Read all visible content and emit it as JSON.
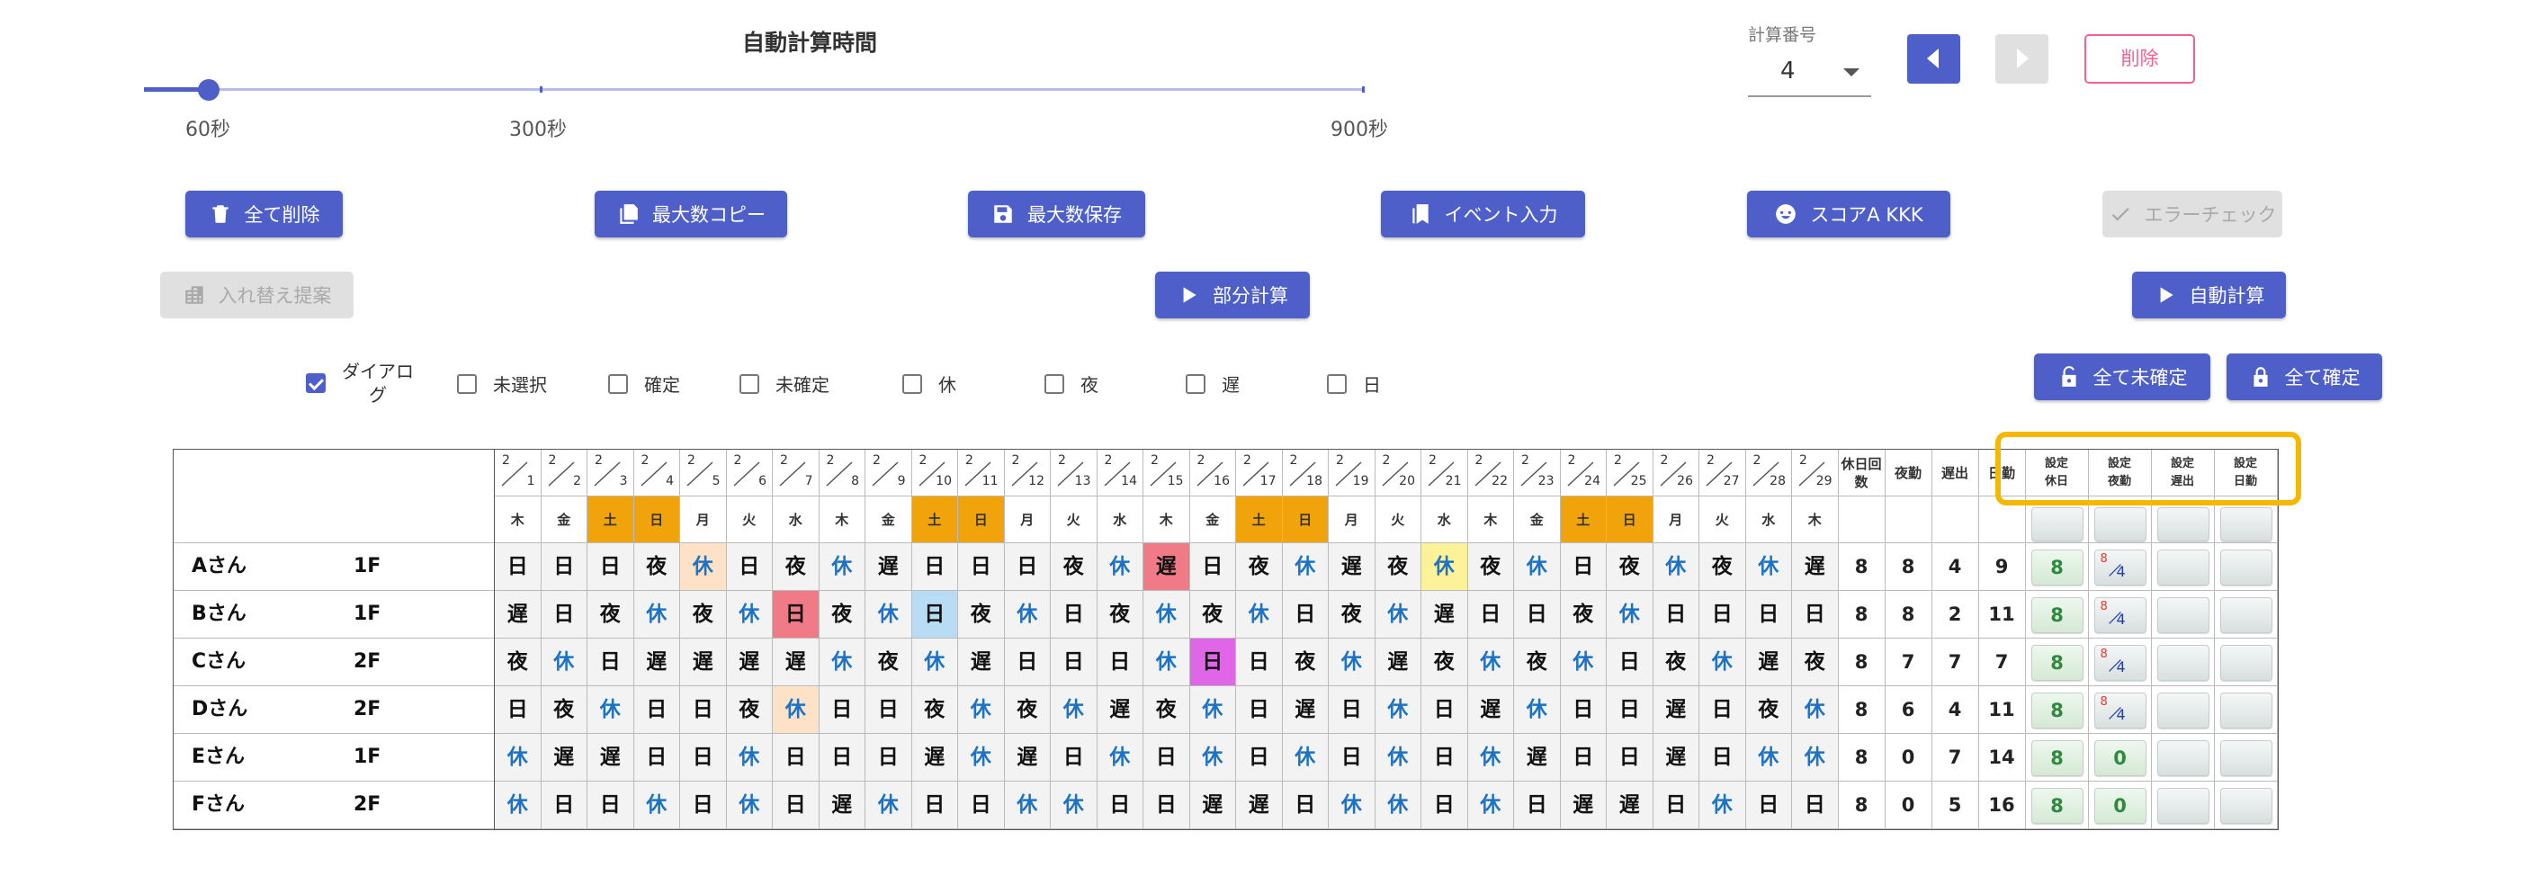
{
  "slider": {
    "title": "自動計算時間",
    "labels": [
      "60秒",
      "300秒",
      "900秒"
    ],
    "value_seconds": 60
  },
  "calc": {
    "label": "計算番号",
    "value": "4",
    "delete_label": "削除"
  },
  "buttons": {
    "delete_all": "全て削除",
    "copy_max": "最大数コピー",
    "save_max": "最大数保存",
    "event_input": "イベント入力",
    "score": "スコアA KKK",
    "error_check": "エラーチェック",
    "swap_suggest": "入れ替え提案",
    "partial_calc": "部分計算",
    "auto_calc": "自動計算",
    "all_unconfirm": "全て未確定",
    "all_confirm": "全て確定"
  },
  "filters": {
    "dialog": "ダイアロ\nグ",
    "unselected": "未選択",
    "confirmed": "確定",
    "unconfirmed": "未確定",
    "rest": "休",
    "night": "夜",
    "late": "遅",
    "day": "日"
  },
  "colors": {
    "accent": "#4e5fc9",
    "weekend": "#f0a30a",
    "rest_text": "#1e72c4",
    "highlight": "#f5b700"
  },
  "table": {
    "month": "2",
    "days": [
      "1",
      "2",
      "3",
      "4",
      "5",
      "6",
      "7",
      "8",
      "9",
      "10",
      "11",
      "12",
      "13",
      "14",
      "15",
      "16",
      "17",
      "18",
      "19",
      "20",
      "21",
      "22",
      "23",
      "24",
      "25",
      "26",
      "27",
      "28",
      "29"
    ],
    "dow": [
      "木",
      "金",
      "土",
      "日",
      "月",
      "火",
      "水",
      "木",
      "金",
      "土",
      "日",
      "月",
      "火",
      "水",
      "木",
      "金",
      "土",
      "日",
      "月",
      "火",
      "水",
      "木",
      "金",
      "土",
      "日",
      "月",
      "火",
      "水",
      "木"
    ],
    "stat_headers": [
      "休日回\n数",
      "夜勤",
      "遅出",
      "日勤"
    ],
    "setting_headers": [
      "設定\n休日",
      "設定\n夜勤",
      "設定\n遅出",
      "設定\n日勤"
    ],
    "rows": [
      {
        "name": "Aさん",
        "floor": "1F",
        "shifts": [
          "日",
          "日",
          "日",
          "夜",
          "休",
          "日",
          "夜",
          "休",
          "遅",
          "日",
          "日",
          "日",
          "夜",
          "休",
          "遅",
          "日",
          "夜",
          "休",
          "遅",
          "夜",
          "休",
          "夜",
          "休",
          "日",
          "夜",
          "休",
          "夜",
          "休",
          "遅"
        ],
        "stats": [
          "8",
          "8",
          "4",
          "9"
        ],
        "set_rest": "8",
        "set_night": {
          "num": "8",
          "den": "4"
        }
      },
      {
        "name": "Bさん",
        "floor": "1F",
        "shifts": [
          "遅",
          "日",
          "夜",
          "休",
          "夜",
          "休",
          "日",
          "夜",
          "休",
          "日",
          "夜",
          "休",
          "日",
          "夜",
          "休",
          "夜",
          "休",
          "日",
          "夜",
          "休",
          "遅",
          "日",
          "日",
          "夜",
          "休",
          "日",
          "日",
          "日",
          "日"
        ],
        "stats": [
          "8",
          "8",
          "2",
          "11"
        ],
        "set_rest": "8",
        "set_night": {
          "num": "8",
          "den": "4"
        }
      },
      {
        "name": "Cさん",
        "floor": "2F",
        "shifts": [
          "夜",
          "休",
          "日",
          "遅",
          "遅",
          "遅",
          "遅",
          "休",
          "夜",
          "休",
          "遅",
          "日",
          "日",
          "日",
          "休",
          "日",
          "日",
          "夜",
          "休",
          "遅",
          "夜",
          "休",
          "夜",
          "休",
          "日",
          "夜",
          "休",
          "遅",
          "夜"
        ],
        "stats": [
          "8",
          "7",
          "7",
          "7"
        ],
        "set_rest": "8",
        "set_night": {
          "num": "8",
          "den": "4"
        }
      },
      {
        "name": "Dさん",
        "floor": "2F",
        "shifts": [
          "日",
          "夜",
          "休",
          "日",
          "日",
          "夜",
          "休",
          "日",
          "日",
          "夜",
          "休",
          "夜",
          "休",
          "遅",
          "夜",
          "休",
          "日",
          "遅",
          "日",
          "休",
          "日",
          "遅",
          "休",
          "日",
          "日",
          "遅",
          "日",
          "夜",
          "休"
        ],
        "stats": [
          "8",
          "6",
          "4",
          "11"
        ],
        "set_rest": "8",
        "set_night": {
          "num": "8",
          "den": "4"
        }
      },
      {
        "name": "Eさん",
        "floor": "1F",
        "shifts": [
          "休",
          "遅",
          "遅",
          "日",
          "日",
          "休",
          "日",
          "日",
          "日",
          "遅",
          "休",
          "遅",
          "日",
          "休",
          "日",
          "休",
          "日",
          "休",
          "日",
          "休",
          "日",
          "休",
          "遅",
          "日",
          "日",
          "遅",
          "日",
          "休",
          "休"
        ],
        "stats": [
          "8",
          "0",
          "7",
          "14"
        ],
        "set_rest": "8",
        "set_night": {
          "num": "0",
          "den": ""
        }
      },
      {
        "name": "Fさん",
        "floor": "2F",
        "shifts": [
          "休",
          "日",
          "日",
          "休",
          "日",
          "休",
          "日",
          "遅",
          "休",
          "日",
          "日",
          "休",
          "休",
          "日",
          "日",
          "遅",
          "遅",
          "日",
          "休",
          "休",
          "日",
          "休",
          "日",
          "遅",
          "遅",
          "日",
          "休",
          "日",
          "日"
        ],
        "stats": [
          "8",
          "0",
          "5",
          "16"
        ],
        "set_rest": "8",
        "set_night": {
          "num": "0",
          "den": ""
        }
      }
    ],
    "cell_highlights": [
      {
        "row": 0,
        "col": 4,
        "color": "#fde2c8"
      },
      {
        "row": 0,
        "col": 14,
        "color": "#f07a86"
      },
      {
        "row": 0,
        "col": 20,
        "color": "#fbf29a"
      },
      {
        "row": 1,
        "col": 6,
        "color": "#f07a86"
      },
      {
        "row": 1,
        "col": 9,
        "color": "#b9dcf5"
      },
      {
        "row": 2,
        "col": 15,
        "color": "#e066e8"
      },
      {
        "row": 3,
        "col": 6,
        "color": "#fde2c8"
      }
    ]
  }
}
